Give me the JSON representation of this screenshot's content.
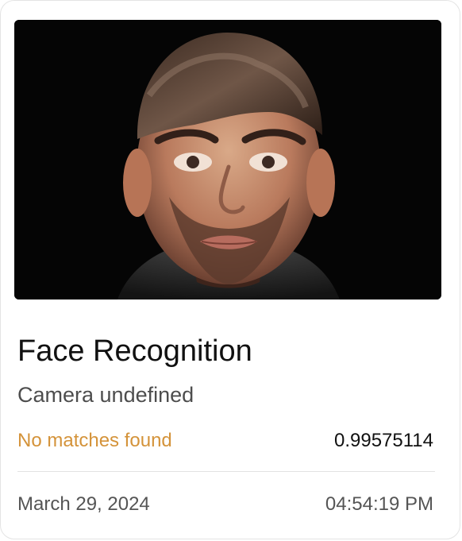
{
  "card": {
    "title": "Face Recognition",
    "subtitle": "Camera undefined",
    "match_status": "No matches found",
    "confidence_score": "0.99575114",
    "date": "March 29, 2024",
    "time": "04:54:19 PM"
  },
  "colors": {
    "match_status": "#d4933a",
    "photo_background": "#050505",
    "title": "#111111",
    "muted_text": "#555555"
  },
  "image": {
    "semantic": "face-photo"
  }
}
